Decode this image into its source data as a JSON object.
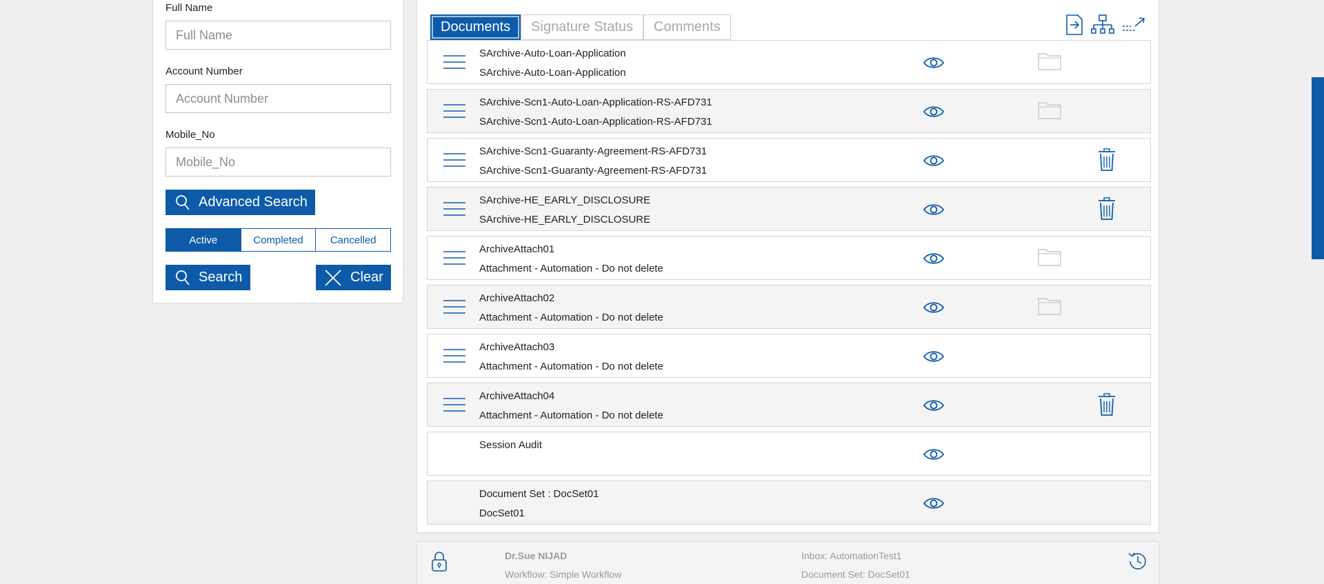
{
  "search": {
    "full_name_label": "Full Name",
    "full_name_placeholder": "Full Name",
    "account_label": "Account Number",
    "account_placeholder": "Account Number",
    "mobile_label": "Mobile_No",
    "mobile_placeholder": "Mobile_No",
    "advanced_search": "Advanced Search",
    "status_options": [
      "Active",
      "Completed",
      "Cancelled"
    ],
    "selected_status": "Active",
    "search_button": "Search",
    "clear_button": "Clear"
  },
  "tabs": [
    {
      "label": "Documents",
      "active": true
    },
    {
      "label": "Signature Status",
      "active": false
    },
    {
      "label": "Comments",
      "active": false
    }
  ],
  "toolbar_icons": [
    "export-icon",
    "workflow-tree-icon",
    "expand-arrow-icon"
  ],
  "documents": [
    {
      "title": "SArchive-Auto-Loan-Application",
      "subtitle": "SArchive-Auto-Loan-Application",
      "action": "folder",
      "draggable": true
    },
    {
      "title": "SArchive-Scn1-Auto-Loan-Application-RS-AFD731",
      "subtitle": "SArchive-Scn1-Auto-Loan-Application-RS-AFD731",
      "action": "folder",
      "draggable": true
    },
    {
      "title": "SArchive-Scn1-Guaranty-Agreement-RS-AFD731",
      "subtitle": "SArchive-Scn1-Guaranty-Agreement-RS-AFD731",
      "action": "trash",
      "draggable": true
    },
    {
      "title": "SArchive-HE_EARLY_DISCLOSURE",
      "subtitle": "SArchive-HE_EARLY_DISCLOSURE",
      "action": "trash",
      "draggable": true
    },
    {
      "title": "ArchiveAttach01",
      "subtitle": "Attachment - Automation - Do not delete",
      "action": "folder",
      "draggable": true
    },
    {
      "title": "ArchiveAttach02",
      "subtitle": "Attachment - Automation - Do not delete",
      "action": "folder",
      "draggable": true
    },
    {
      "title": "ArchiveAttach03",
      "subtitle": "Attachment - Automation - Do not delete",
      "action": "none",
      "draggable": true
    },
    {
      "title": "ArchiveAttach04",
      "subtitle": "Attachment - Automation - Do not delete",
      "action": "trash",
      "draggable": true
    },
    {
      "title": "Session Audit",
      "subtitle": "",
      "action": "none",
      "draggable": false
    },
    {
      "title": "Document Set : DocSet01",
      "subtitle": "DocSet01",
      "action": "none",
      "draggable": false
    }
  ],
  "footer": {
    "user": "Dr.Sue NIJAD",
    "workflow": "Workflow: Simple Workflow",
    "inbox": "Inbox: AutomationTest1",
    "document_set": "Document Set: DocSet01"
  },
  "colors": {
    "accent": "#0d5ba8",
    "row_alt": "#f4f4f4",
    "muted_text": "#9a9a9a"
  }
}
